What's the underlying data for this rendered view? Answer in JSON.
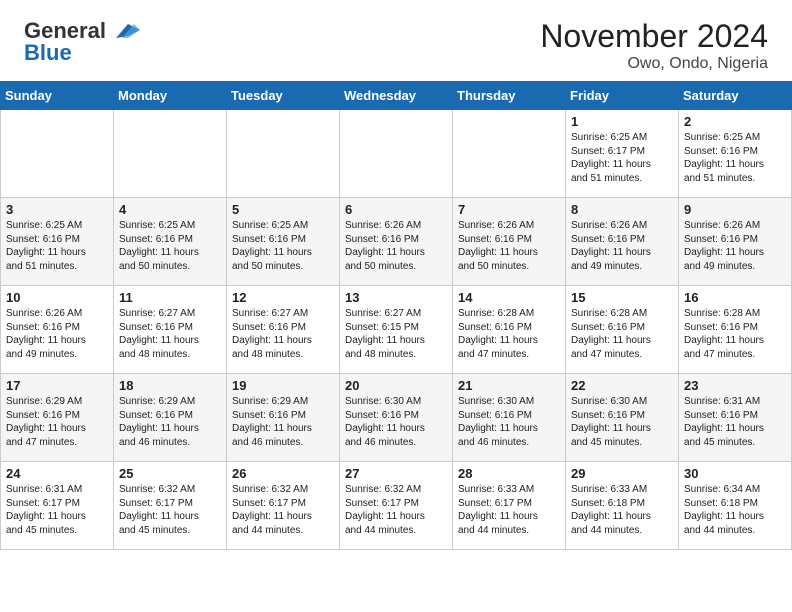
{
  "logo": {
    "line1": "General",
    "line2": "Blue"
  },
  "title": "November 2024",
  "subtitle": "Owo, Ondo, Nigeria",
  "days_of_week": [
    "Sunday",
    "Monday",
    "Tuesday",
    "Wednesday",
    "Thursday",
    "Friday",
    "Saturday"
  ],
  "weeks": [
    [
      {
        "day": "",
        "info": ""
      },
      {
        "day": "",
        "info": ""
      },
      {
        "day": "",
        "info": ""
      },
      {
        "day": "",
        "info": ""
      },
      {
        "day": "",
        "info": ""
      },
      {
        "day": "1",
        "info": "Sunrise: 6:25 AM\nSunset: 6:17 PM\nDaylight: 11 hours\nand 51 minutes."
      },
      {
        "day": "2",
        "info": "Sunrise: 6:25 AM\nSunset: 6:16 PM\nDaylight: 11 hours\nand 51 minutes."
      }
    ],
    [
      {
        "day": "3",
        "info": "Sunrise: 6:25 AM\nSunset: 6:16 PM\nDaylight: 11 hours\nand 51 minutes."
      },
      {
        "day": "4",
        "info": "Sunrise: 6:25 AM\nSunset: 6:16 PM\nDaylight: 11 hours\nand 50 minutes."
      },
      {
        "day": "5",
        "info": "Sunrise: 6:25 AM\nSunset: 6:16 PM\nDaylight: 11 hours\nand 50 minutes."
      },
      {
        "day": "6",
        "info": "Sunrise: 6:26 AM\nSunset: 6:16 PM\nDaylight: 11 hours\nand 50 minutes."
      },
      {
        "day": "7",
        "info": "Sunrise: 6:26 AM\nSunset: 6:16 PM\nDaylight: 11 hours\nand 50 minutes."
      },
      {
        "day": "8",
        "info": "Sunrise: 6:26 AM\nSunset: 6:16 PM\nDaylight: 11 hours\nand 49 minutes."
      },
      {
        "day": "9",
        "info": "Sunrise: 6:26 AM\nSunset: 6:16 PM\nDaylight: 11 hours\nand 49 minutes."
      }
    ],
    [
      {
        "day": "10",
        "info": "Sunrise: 6:26 AM\nSunset: 6:16 PM\nDaylight: 11 hours\nand 49 minutes."
      },
      {
        "day": "11",
        "info": "Sunrise: 6:27 AM\nSunset: 6:16 PM\nDaylight: 11 hours\nand 48 minutes."
      },
      {
        "day": "12",
        "info": "Sunrise: 6:27 AM\nSunset: 6:16 PM\nDaylight: 11 hours\nand 48 minutes."
      },
      {
        "day": "13",
        "info": "Sunrise: 6:27 AM\nSunset: 6:15 PM\nDaylight: 11 hours\nand 48 minutes."
      },
      {
        "day": "14",
        "info": "Sunrise: 6:28 AM\nSunset: 6:16 PM\nDaylight: 11 hours\nand 47 minutes."
      },
      {
        "day": "15",
        "info": "Sunrise: 6:28 AM\nSunset: 6:16 PM\nDaylight: 11 hours\nand 47 minutes."
      },
      {
        "day": "16",
        "info": "Sunrise: 6:28 AM\nSunset: 6:16 PM\nDaylight: 11 hours\nand 47 minutes."
      }
    ],
    [
      {
        "day": "17",
        "info": "Sunrise: 6:29 AM\nSunset: 6:16 PM\nDaylight: 11 hours\nand 47 minutes."
      },
      {
        "day": "18",
        "info": "Sunrise: 6:29 AM\nSunset: 6:16 PM\nDaylight: 11 hours\nand 46 minutes."
      },
      {
        "day": "19",
        "info": "Sunrise: 6:29 AM\nSunset: 6:16 PM\nDaylight: 11 hours\nand 46 minutes."
      },
      {
        "day": "20",
        "info": "Sunrise: 6:30 AM\nSunset: 6:16 PM\nDaylight: 11 hours\nand 46 minutes."
      },
      {
        "day": "21",
        "info": "Sunrise: 6:30 AM\nSunset: 6:16 PM\nDaylight: 11 hours\nand 46 minutes."
      },
      {
        "day": "22",
        "info": "Sunrise: 6:30 AM\nSunset: 6:16 PM\nDaylight: 11 hours\nand 45 minutes."
      },
      {
        "day": "23",
        "info": "Sunrise: 6:31 AM\nSunset: 6:16 PM\nDaylight: 11 hours\nand 45 minutes."
      }
    ],
    [
      {
        "day": "24",
        "info": "Sunrise: 6:31 AM\nSunset: 6:17 PM\nDaylight: 11 hours\nand 45 minutes."
      },
      {
        "day": "25",
        "info": "Sunrise: 6:32 AM\nSunset: 6:17 PM\nDaylight: 11 hours\nand 45 minutes."
      },
      {
        "day": "26",
        "info": "Sunrise: 6:32 AM\nSunset: 6:17 PM\nDaylight: 11 hours\nand 44 minutes."
      },
      {
        "day": "27",
        "info": "Sunrise: 6:32 AM\nSunset: 6:17 PM\nDaylight: 11 hours\nand 44 minutes."
      },
      {
        "day": "28",
        "info": "Sunrise: 6:33 AM\nSunset: 6:17 PM\nDaylight: 11 hours\nand 44 minutes."
      },
      {
        "day": "29",
        "info": "Sunrise: 6:33 AM\nSunset: 6:18 PM\nDaylight: 11 hours\nand 44 minutes."
      },
      {
        "day": "30",
        "info": "Sunrise: 6:34 AM\nSunset: 6:18 PM\nDaylight: 11 hours\nand 44 minutes."
      }
    ]
  ]
}
